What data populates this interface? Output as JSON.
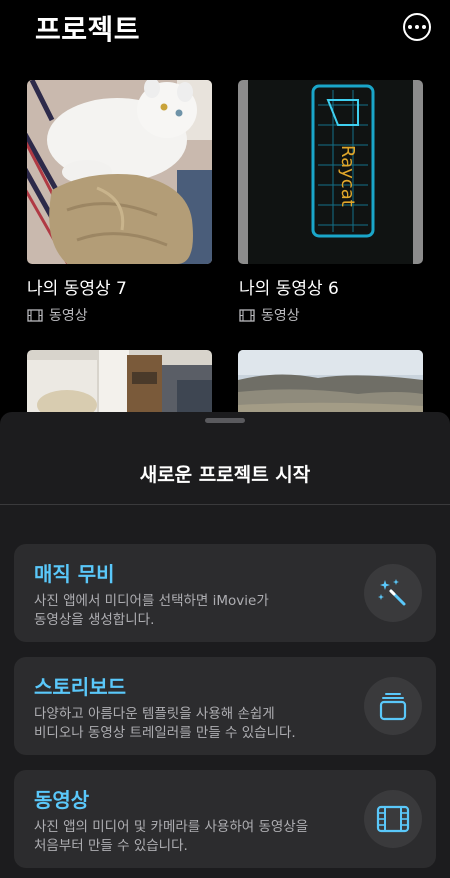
{
  "header": {
    "title": "프로젝트",
    "more_icon": "ellipsis-circle-icon"
  },
  "projects": [
    {
      "title": "나의 동영상 7",
      "type": "동영상",
      "type_icon": "film-icon"
    },
    {
      "title": "나의 동영상 6",
      "type": "동영상",
      "type_icon": "film-icon"
    }
  ],
  "sheet": {
    "title": "새로운 프로젝트 시작",
    "options": [
      {
        "title": "매직 무비",
        "desc_line1": "사진 앱에서 미디어를 선택하면 iMovie가",
        "desc_line2": "동영상을 생성합니다.",
        "icon": "magic-wand-icon"
      },
      {
        "title": "스토리보드",
        "desc_line1": "다양하고 아름다운 템플릿을 사용해 손쉽게",
        "desc_line2": "비디오나 동영상 트레일러를 만들 수 있습니다.",
        "icon": "storyboard-stack-icon"
      },
      {
        "title": "동영상",
        "desc_line1": "사진 앱의 미디어 및 카메라를 사용하여 동영상을",
        "desc_line2": "처음부터 만들 수 있습니다.",
        "icon": "film-icon"
      }
    ]
  },
  "colors": {
    "accent": "#5ac8fa",
    "background": "#000000",
    "sheet": "#1c1c1e",
    "card": "#2c2c2e"
  }
}
